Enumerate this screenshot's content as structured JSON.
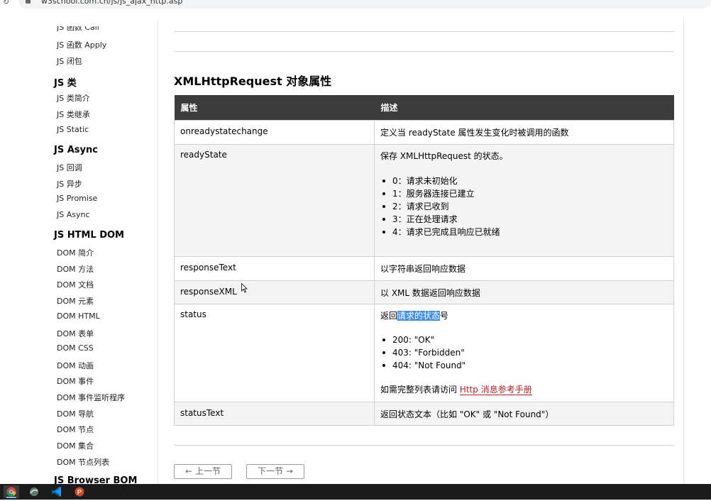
{
  "browser": {
    "url": "w3school.com.cn/js/js_ajax_http.asp",
    "reload_icon": "reload-icon",
    "lock_icon": "lock-icon"
  },
  "sidebar": {
    "partial_top": "JS 函数 Call",
    "items": [
      {
        "type": "link",
        "label": "JS 函数 Apply"
      },
      {
        "type": "link",
        "label": "JS 闭包"
      },
      {
        "type": "head",
        "label": "JS 类"
      },
      {
        "type": "link",
        "label": "JS 类简介"
      },
      {
        "type": "link",
        "label": "JS 类继承"
      },
      {
        "type": "link",
        "label": "JS Static"
      },
      {
        "type": "head",
        "label": "JS Async"
      },
      {
        "type": "link",
        "label": "JS 回调"
      },
      {
        "type": "link",
        "label": "JS 异步"
      },
      {
        "type": "link",
        "label": "JS Promise"
      },
      {
        "type": "link",
        "label": "JS Async"
      },
      {
        "type": "head",
        "label": "JS HTML DOM"
      },
      {
        "type": "link",
        "label": "DOM 简介"
      },
      {
        "type": "link",
        "label": "DOM 方法"
      },
      {
        "type": "link",
        "label": "DOM 文档"
      },
      {
        "type": "link",
        "label": "DOM 元素"
      },
      {
        "type": "link",
        "label": "DOM HTML"
      },
      {
        "type": "link",
        "label": "DOM 表单"
      },
      {
        "type": "link",
        "label": "DOM CSS"
      },
      {
        "type": "link",
        "label": "DOM 动画"
      },
      {
        "type": "link",
        "label": "DOM 事件"
      },
      {
        "type": "link",
        "label": "DOM 事件监听程序"
      },
      {
        "type": "link",
        "label": "DOM 导航"
      },
      {
        "type": "link",
        "label": "DOM 节点"
      },
      {
        "type": "link",
        "label": "DOM 集合"
      },
      {
        "type": "link",
        "label": "DOM 节点列表"
      },
      {
        "type": "head",
        "label": "JS Browser BOM"
      }
    ]
  },
  "main": {
    "section_title": "XMLHttpRequest 对象属性",
    "table": {
      "headers": [
        "属性",
        "描述"
      ],
      "rows": {
        "onreadystatechange": {
          "name": "onreadystatechange",
          "desc": "定义当 readyState 属性发生变化时被调用的函数"
        },
        "readyState": {
          "name": "readyState",
          "desc": "保存 XMLHttpRequest 的状态。",
          "values": [
            "0：请求未初始化",
            "1：服务器连接已建立",
            "2：请求已收到",
            "3：正在处理请求",
            "4：请求已完成且响应已就绪"
          ]
        },
        "responseText": {
          "name": "responseText",
          "desc": "以字符串返回响应数据"
        },
        "responseXML": {
          "name": "responseXML",
          "desc": "以 XML 数据返回响应数据"
        },
        "status": {
          "name": "status",
          "desc_before": "返回",
          "desc_highlight": "请求的状态",
          "desc_after": "号",
          "values": [
            "200: \"OK\"",
            "403: \"Forbidden\"",
            "404: \"Not Found\""
          ],
          "note_prefix": "如需完整列表请访问 ",
          "note_link": "Http 消息参考手册"
        },
        "statusText": {
          "name": "statusText",
          "desc": "返回状态文本（比如 \"OK\" 或 \"Not Found\"）"
        }
      }
    },
    "nav": {
      "prev_label": "上一节",
      "next_label": "下一节",
      "prev_icon": "arrow-left-icon",
      "next_icon": "arrow-right-icon"
    }
  },
  "taskbar": {
    "items": [
      "chrome-icon",
      "app-icon",
      "vscode-icon",
      "powerpoint-icon"
    ]
  }
}
